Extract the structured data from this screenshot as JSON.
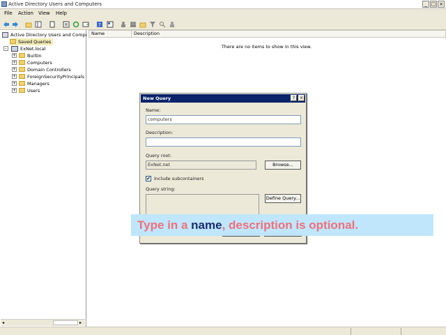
{
  "window": {
    "title": "Active Directory Users and Computers"
  },
  "menu": {
    "file": "File",
    "action": "Action",
    "view": "View",
    "help": "Help"
  },
  "tree": {
    "root": "Active Directory Users and Comput...",
    "saved_queries": "Saved Queries",
    "domain": "ExNet.local",
    "items": [
      "Builtin",
      "Computers",
      "Domain Controllers",
      "ForeignSecurityPrincipals",
      "Managers",
      "Users"
    ]
  },
  "list": {
    "col_name": "Name",
    "col_description": "Description",
    "empty": "There are no items to show in this view."
  },
  "dialog": {
    "title": "New Query",
    "help_btn": "?",
    "close_btn": "×",
    "name_label": "Name:",
    "name_value": "computers",
    "description_label": "Description:",
    "description_value": "",
    "query_root_label": "Query root:",
    "query_root_value": "ExNet.net",
    "browse_label": "Browse...",
    "include_subcontainers_label": "Include subcontainers",
    "include_subcontainers_checked": "✔",
    "query_string_label": "Query string:",
    "define_query_label": "Define Query..."
  },
  "overlay": {
    "part1": "Type in a ",
    "highlight": "name",
    "part2": ", description is optional."
  }
}
